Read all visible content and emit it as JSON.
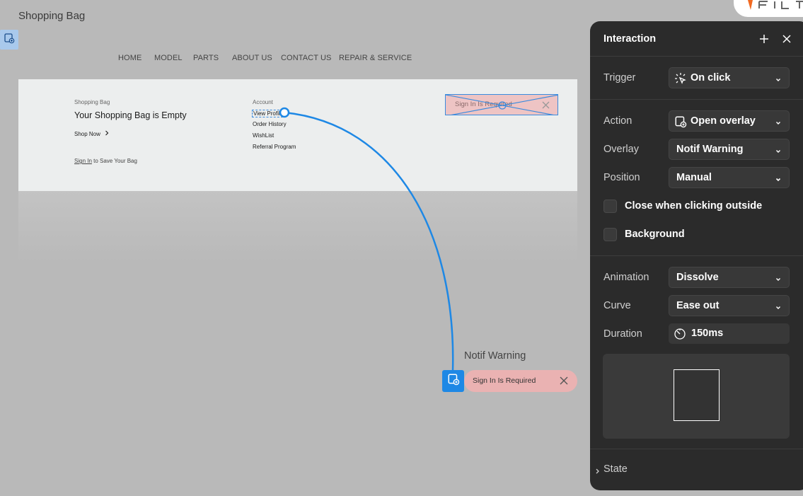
{
  "canvas": {
    "frame_title": "Shopping Bag",
    "nav": [
      "HOME",
      "MODEL",
      "PARTS",
      "ABOUT US",
      "CONTACT US",
      "REPAIR & SERVICE"
    ],
    "bag": {
      "label": "Shopping Bag",
      "title": "Your Shopping Bag is Empty",
      "shop_now": "Shop Now",
      "sign_in": "Sign In",
      "save_text": " to Save Your Bag"
    },
    "account": {
      "label": "Account",
      "links": [
        "View Profile",
        "Order History",
        "WishList",
        "Referral Program"
      ]
    },
    "selected_overlay_text": "Sign In Is Required",
    "notif": {
      "label": "Notif Warning",
      "text": "Sign In Is Required"
    },
    "colors": {
      "link_blue": "#1e88e5",
      "notif_pink": "#eab2b2"
    }
  },
  "panel": {
    "title": "Interaction",
    "trigger_label": "Trigger",
    "trigger_value": "On click",
    "action_label": "Action",
    "action_value": "Open overlay",
    "overlay_label": "Overlay",
    "overlay_value": "Notif Warning",
    "position_label": "Position",
    "position_value": "Manual",
    "close_outside_label": "Close when clicking outside",
    "background_label": "Background",
    "animation_label": "Animation",
    "animation_value": "Dissolve",
    "curve_label": "Curve",
    "curve_value": "Ease out",
    "duration_label": "Duration",
    "duration_value": "150ms",
    "state_label": "State"
  }
}
